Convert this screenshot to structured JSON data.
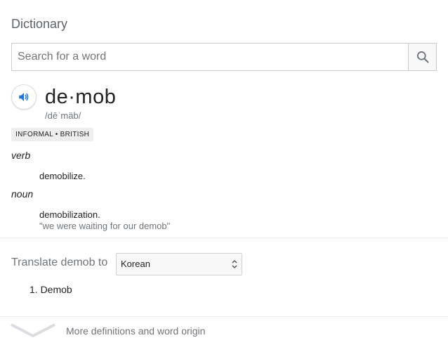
{
  "panel": {
    "title": "Dictionary"
  },
  "search": {
    "placeholder": "Search for a word",
    "value": ""
  },
  "entry": {
    "word": "de·mob",
    "phonetic": "/dēˈmäb/",
    "tag": "INFORMAL • BRITISH",
    "senses": [
      {
        "pos": "verb",
        "definition": "demobilize.",
        "example": ""
      },
      {
        "pos": "noun",
        "definition": "demobilization.",
        "example": "\"we were waiting for our demob\""
      }
    ]
  },
  "translate": {
    "label": "Translate demob to",
    "language": "Korean",
    "results": [
      "1. Demob"
    ]
  },
  "footer": {
    "more_label": "More definitions and word origin"
  },
  "colors": {
    "accent": "#1a73e8",
    "muted": "#70757a",
    "divider": "#ebebeb"
  },
  "icons": [
    "search-icon",
    "speaker-icon",
    "select-arrows-icon",
    "chevron-down-icon"
  ]
}
